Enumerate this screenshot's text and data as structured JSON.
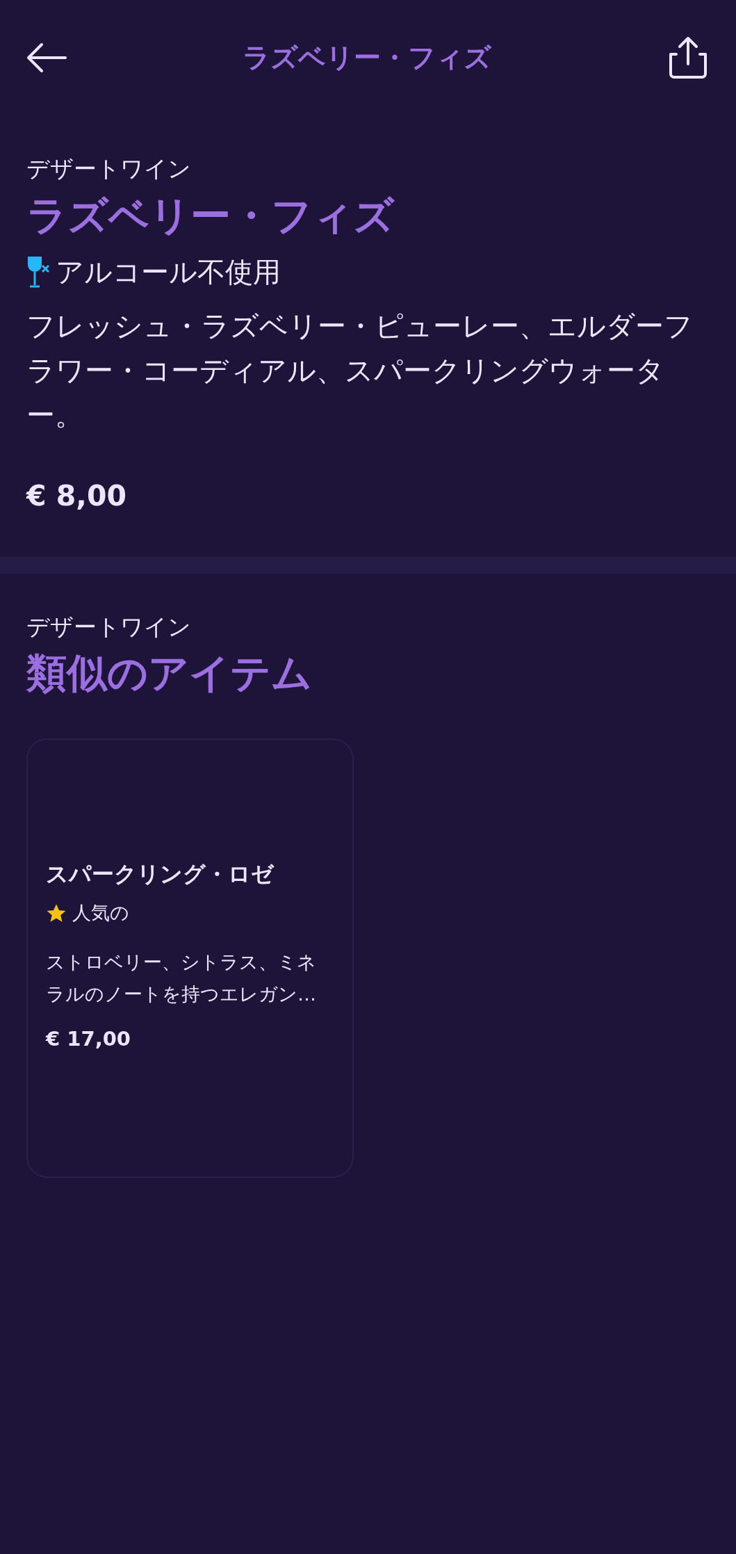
{
  "header": {
    "title": "ラズベリー・フィズ"
  },
  "item": {
    "category": "デザートワイン",
    "name": "ラズベリー・フィズ",
    "tags": [
      {
        "kind": "alcohol_free",
        "label": "アルコール不使用"
      }
    ],
    "description": "フレッシュ・ラズベリー・ピューレー、エルダーフラワー・コーディアル、スパークリングウォーター。",
    "price": "€ 8,00"
  },
  "similar": {
    "category": "デザートワイン",
    "title": "類似のアイテム",
    "items": [
      {
        "name": "スパークリング・ロゼ",
        "badges": [
          {
            "kind": "popular",
            "label": "人気の"
          }
        ],
        "description": "ストロベリー、シトラス、ミネラルのノートを持つエレガン…",
        "price": "€ 17,00"
      }
    ]
  }
}
